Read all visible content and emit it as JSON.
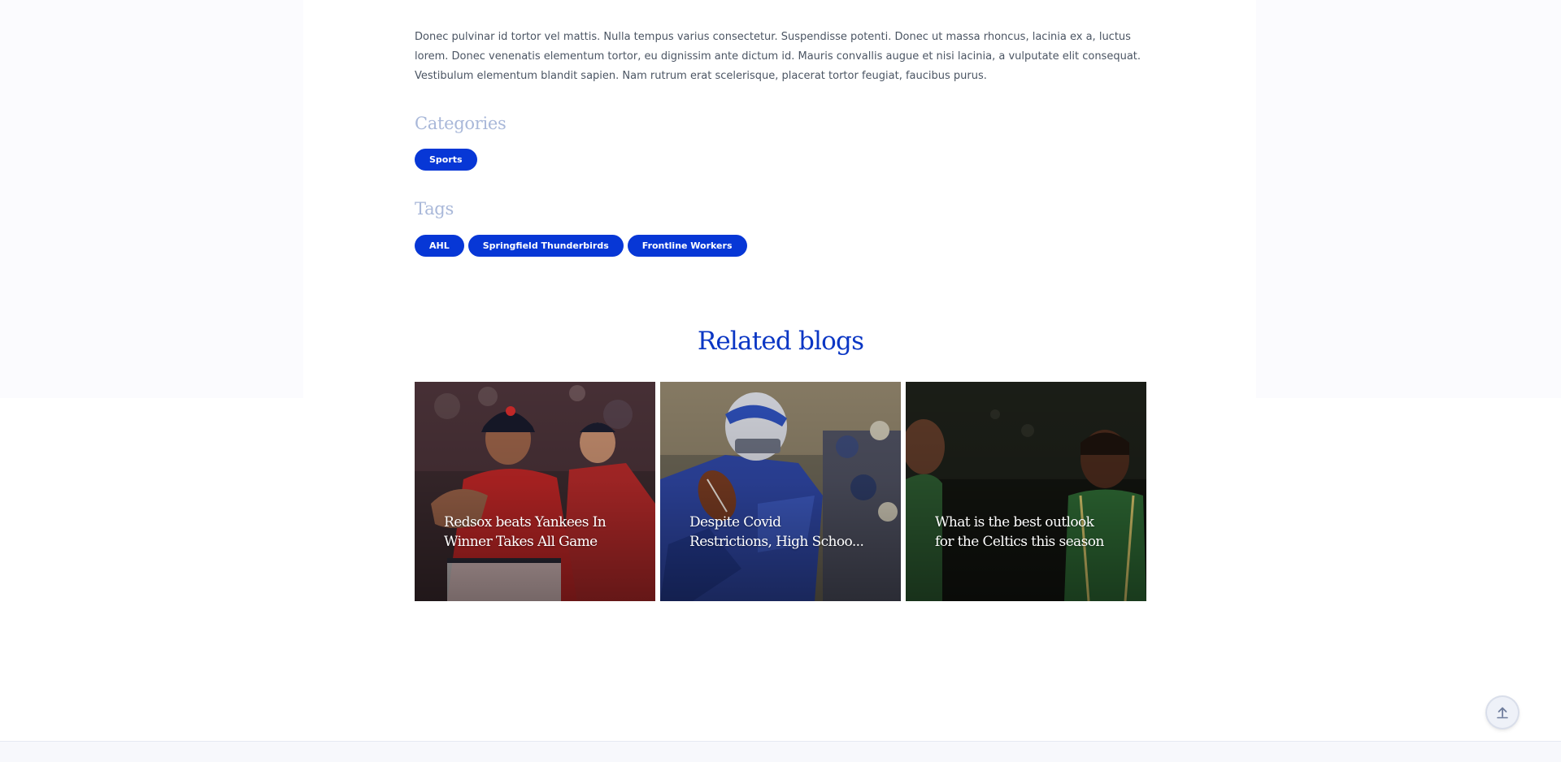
{
  "article": {
    "intro_text": "Donec pulvinar id tortor vel mattis. Nulla tempus varius consectetur. Suspendisse potenti. Donec ut massa rhoncus, lacinia ex a, luctus lorem. Donec venenatis elementum tortor, eu dignissim ante dictum id. Mauris convallis augue et nisi lacinia, a vulputate elit consequat. Vestibulum elementum blandit sapien. Nam rutrum erat scelerisque, placerat tortor feugiat, faucibus purus."
  },
  "categories": {
    "heading": "Categories",
    "items": [
      "Sports"
    ]
  },
  "tags": {
    "heading": "Tags",
    "items": [
      "AHL",
      "Springfield Thunderbirds",
      "Frontline Workers"
    ]
  },
  "related": {
    "heading": "Related blogs",
    "cards": [
      {
        "title": "Redsox beats Yankees In\nWinner Takes All Game"
      },
      {
        "title": "Despite Covid\nRestrictions, High Schoo..."
      },
      {
        "title": "What is the best outlook\nfor the Celtics this season"
      }
    ]
  },
  "colors": {
    "accent": "#0737d6",
    "heading_blue": "#0a36c4",
    "muted_heading": "#a9b8d9"
  },
  "icons": {
    "scroll_top": "arrow-up-icon"
  }
}
